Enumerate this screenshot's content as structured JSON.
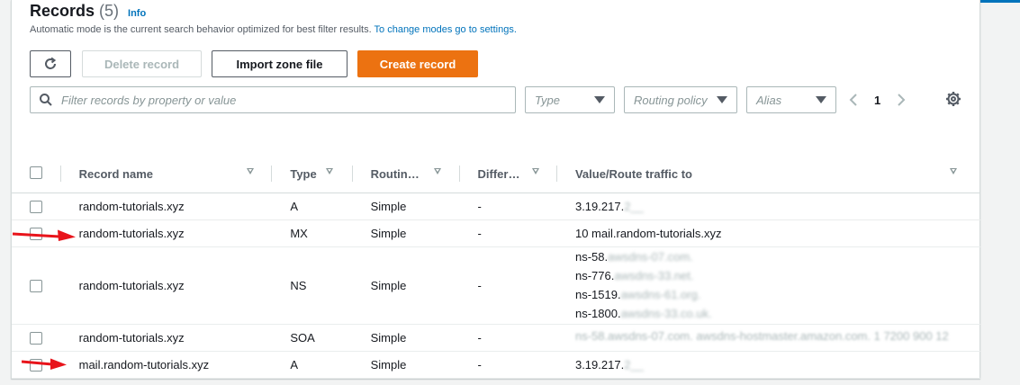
{
  "header": {
    "title": "Records",
    "count": "(5)",
    "info": "Info",
    "description": "Automatic mode is the current search behavior optimized for best filter results.",
    "settings_link": "To change modes go to settings."
  },
  "toolbar": {
    "delete_label": "Delete record",
    "import_label": "Import zone file",
    "create_label": "Create record"
  },
  "filters": {
    "search_placeholder": "Filter records by property or value",
    "type_placeholder": "Type",
    "routing_placeholder": "Routing policy",
    "alias_placeholder": "Alias"
  },
  "pagination": {
    "current_page": "1"
  },
  "table": {
    "columns": [
      "Record name",
      "Type",
      "Routin…",
      "Differ…",
      "Value/Route traffic to"
    ],
    "rows": [
      {
        "name": "random-tutorials.xyz",
        "type": "A",
        "routing": "Simple",
        "differ": "-",
        "value": [
          "3.19.217.",
          "2__"
        ]
      },
      {
        "name": "random-tutorials.xyz",
        "type": "MX",
        "routing": "Simple",
        "differ": "-",
        "value": [
          "10 mail.random-tutorials.xyz"
        ]
      },
      {
        "name": "random-tutorials.xyz",
        "type": "NS",
        "routing": "Simple",
        "differ": "-",
        "value": [
          "ns-58.",
          "awsdns-07.com.",
          "ns-776.",
          "awsdns-33.net.",
          "ns-1519.",
          "awsdns-61.org.",
          "ns-1800.",
          "awsdns-33.co.uk."
        ]
      },
      {
        "name": "random-tutorials.xyz",
        "type": "SOA",
        "routing": "Simple",
        "differ": "-",
        "value": [
          "ns-58.awsdns-07.com. awsdns-hostmaster.amazon.com. 1 7200 900 12"
        ]
      },
      {
        "name": "mail.random-tutorials.xyz",
        "type": "A",
        "routing": "Simple",
        "differ": "-",
        "value": [
          "3.19.217.",
          "2__"
        ]
      }
    ]
  },
  "colors": {
    "accent": "#ec7211",
    "link": "#0073bb",
    "annotation_arrow": "#e8141b"
  },
  "icons": {
    "refresh": "refresh-icon",
    "search": "search-icon",
    "settings": "gear-icon",
    "prev": "chevron-left-icon",
    "next": "chevron-right-icon"
  }
}
